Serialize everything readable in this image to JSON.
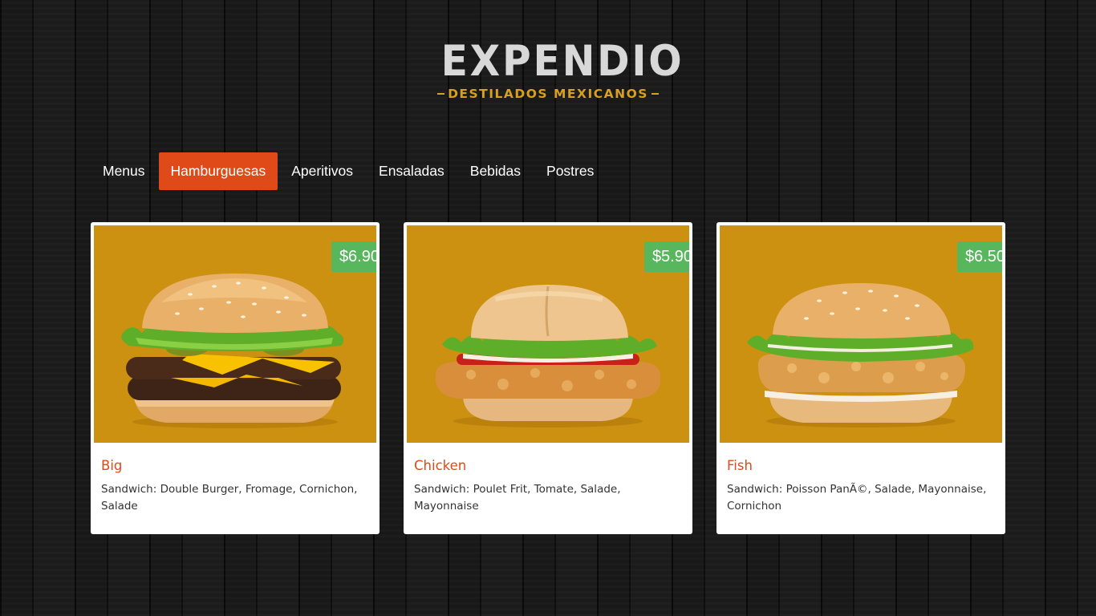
{
  "logo": {
    "main": "EXPENDIO",
    "sub": "DESTILADOS MEXICANOS"
  },
  "nav": {
    "items": [
      {
        "label": "Menus",
        "active": false
      },
      {
        "label": "Hamburguesas",
        "active": true
      },
      {
        "label": "Aperitivos",
        "active": false
      },
      {
        "label": "Ensaladas",
        "active": false
      },
      {
        "label": "Bebidas",
        "active": false
      },
      {
        "label": "Postres",
        "active": false
      }
    ]
  },
  "products": [
    {
      "name": "Big",
      "price": "$6.90",
      "description": "Sandwich: Double Burger, Fromage, Cornichon, Salade"
    },
    {
      "name": "Chicken",
      "price": "$5.90",
      "description": "Sandwich: Poulet Frit, Tomate, Salade, Mayonnaise"
    },
    {
      "name": "Fish",
      "price": "$6.50",
      "description": "Sandwich: Poisson PanÃ©, Salade, Mayonnaise, Cornichon"
    }
  ],
  "colors": {
    "accent": "#e04a18",
    "price_badge": "#58b75c",
    "image_bg": "#cc9110",
    "logo_gold": "#d6a020"
  }
}
